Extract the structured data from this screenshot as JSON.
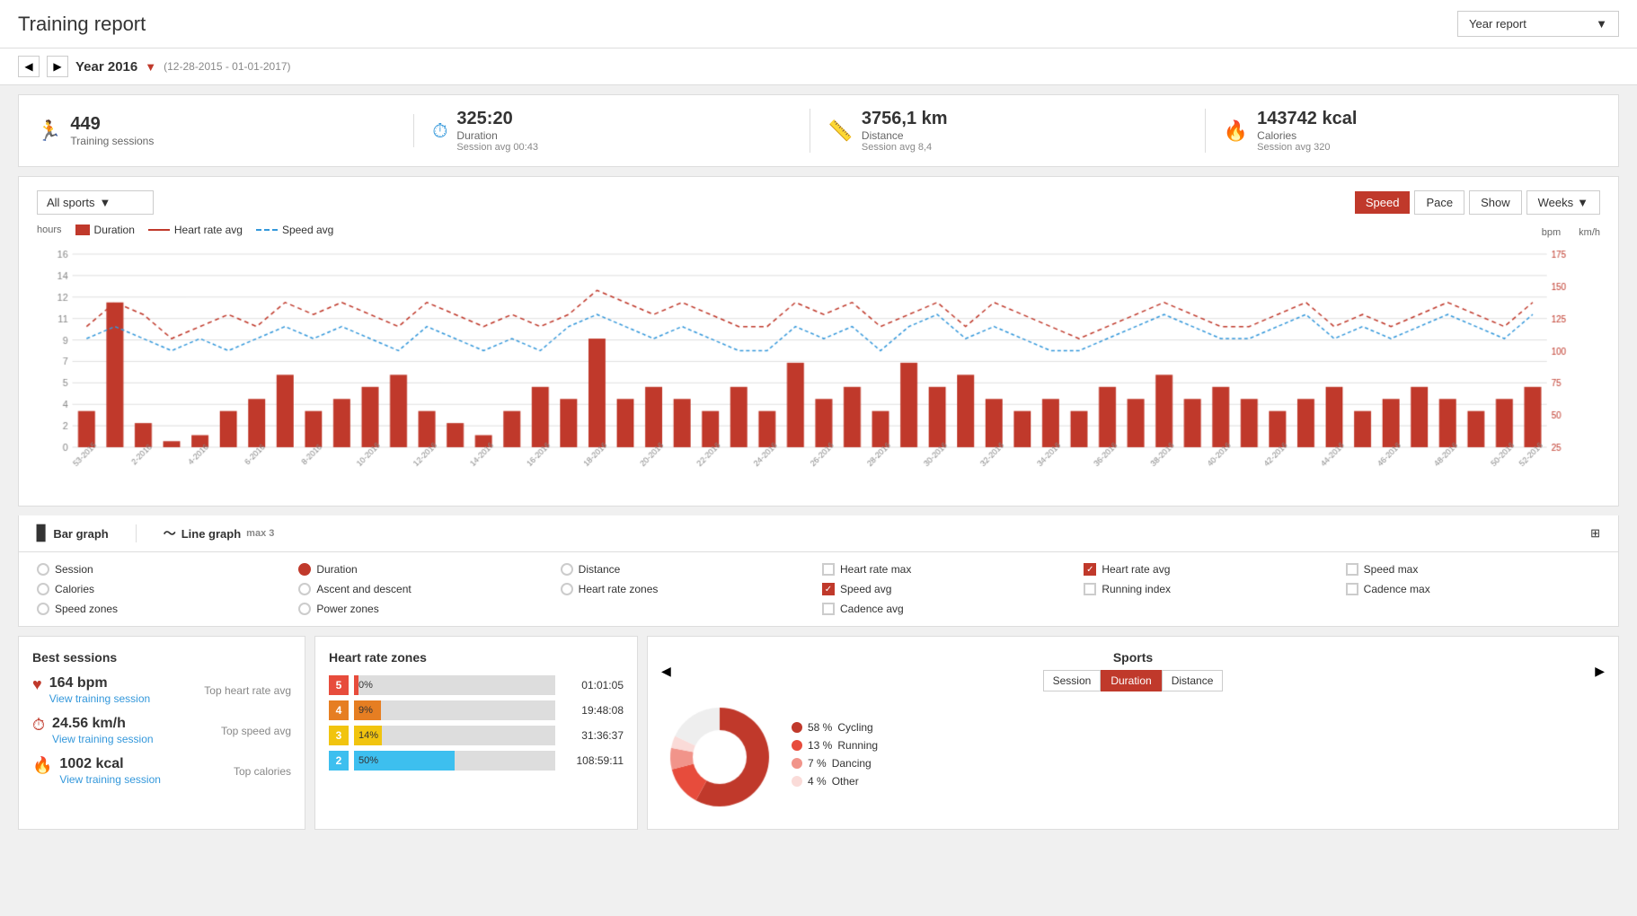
{
  "header": {
    "title": "Training report",
    "year_report_label": "Year report"
  },
  "nav": {
    "year_label": "Year 2016",
    "date_range": "(12-28-2015 - 01-01-2017)"
  },
  "stats": [
    {
      "icon": "🏃",
      "number": "449",
      "label": "Training sessions",
      "sub": ""
    },
    {
      "icon": "⏱",
      "number": "325:20",
      "label": "Duration",
      "sub": "Session avg 00:43"
    },
    {
      "icon": "📏",
      "number": "3756,1 km",
      "label": "Distance",
      "sub": "Session avg 8,4"
    },
    {
      "icon": "🔥",
      "number": "143742 kcal",
      "label": "Calories",
      "sub": "Session avg 320"
    }
  ],
  "chart_controls": {
    "sports_select": "All sports",
    "btn_speed": "Speed",
    "btn_pace": "Pace",
    "btn_show": "Show",
    "btn_weeks": "Weeks"
  },
  "chart_legend": {
    "duration": "Duration",
    "heart_rate_avg": "Heart rate avg",
    "speed_avg": "Speed avg",
    "hours": "hours",
    "bpm": "bpm",
    "kmh": "km/h"
  },
  "graph_types": {
    "bar_label": "Bar graph",
    "line_label": "Line graph",
    "max_label": "max 3"
  },
  "checkboxes": [
    {
      "label": "Session",
      "type": "circle",
      "checked": false
    },
    {
      "label": "Duration",
      "type": "circle",
      "checked": true
    },
    {
      "label": "Distance",
      "type": "circle",
      "checked": false
    },
    {
      "label": "Heart rate max",
      "type": "square",
      "checked": false
    },
    {
      "label": "Heart rate avg",
      "type": "square",
      "checked": true
    },
    {
      "label": "Speed max",
      "type": "square",
      "checked": false
    },
    {
      "label": "Calories",
      "type": "circle",
      "checked": false
    },
    {
      "label": "Ascent and descent",
      "type": "circle",
      "checked": false
    },
    {
      "label": "Heart rate zones",
      "type": "circle",
      "checked": false
    },
    {
      "label": "Speed avg",
      "type": "square",
      "checked": true
    },
    {
      "label": "Running index",
      "type": "square",
      "checked": false
    },
    {
      "label": "Cadence max",
      "type": "square",
      "checked": false
    },
    {
      "label": "Speed zones",
      "type": "circle",
      "checked": false
    },
    {
      "label": "Power zones",
      "type": "circle",
      "checked": false
    },
    {
      "label": "",
      "type": "none",
      "checked": false
    },
    {
      "label": "Cadence avg",
      "type": "square",
      "checked": false
    },
    {
      "label": "",
      "type": "none",
      "checked": false
    },
    {
      "label": "",
      "type": "none",
      "checked": false
    }
  ],
  "best_sessions": {
    "title": "Best sessions",
    "items": [
      {
        "icon": "♥",
        "value": "164 bpm",
        "link": "View training session",
        "label": "Top heart rate avg"
      },
      {
        "icon": "⏱",
        "value": "24.56 km/h",
        "link": "View training session",
        "label": "Top speed avg"
      },
      {
        "icon": "🔥",
        "value": "1002 kcal",
        "link": "View training session",
        "label": "Top calories"
      }
    ]
  },
  "hr_zones": {
    "title": "Heart rate zones",
    "zones": [
      {
        "num": 5,
        "color": "#e74c3c",
        "percent": 0,
        "percent_label": "0%",
        "time": "01:01:05"
      },
      {
        "num": 4,
        "color": "#e67e22",
        "percent": 9,
        "percent_label": "9%",
        "time": "19:48:08"
      },
      {
        "num": 3,
        "color": "#f1c40f",
        "percent": 14,
        "percent_label": "14%",
        "time": "31:36:37"
      },
      {
        "num": 2,
        "color": "#3dbfef",
        "percent": 50,
        "percent_label": "50%",
        "time": "108:59:11"
      }
    ]
  },
  "sports": {
    "title": "Sports",
    "tabs": [
      "Session",
      "Duration",
      "Distance"
    ],
    "active_tab": "Duration",
    "nav_prev": "◀",
    "nav_next": "▶",
    "items": [
      {
        "label": "Cycling",
        "percent": "58 %",
        "color": "#c0392b"
      },
      {
        "label": "Running",
        "percent": "13 %",
        "color": "#e74c3c"
      },
      {
        "label": "Dancing",
        "percent": "7 %",
        "color": "#f1948a"
      },
      {
        "label": "Other",
        "percent": "4 %",
        "color": "#fadbd8"
      }
    ]
  }
}
